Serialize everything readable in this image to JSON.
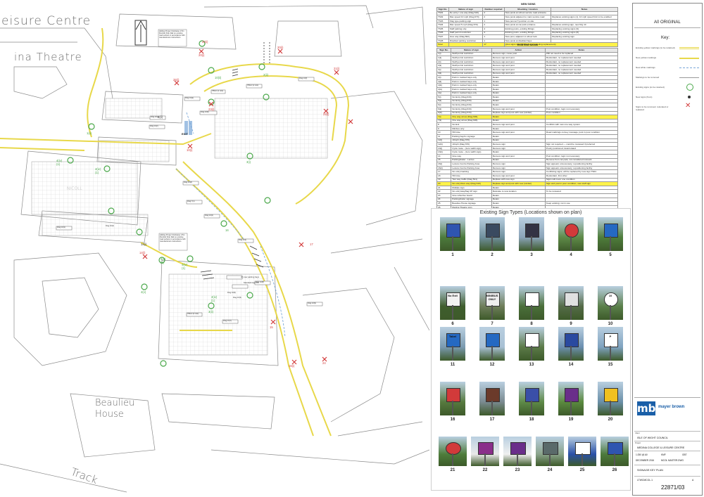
{
  "plan": {
    "labels": {
      "leisure": "eisure Centre",
      "theatre": "ina Theatre",
      "beaulieu1": "Beaulieu",
      "beaulieu2": "House",
      "track": "Track",
      "nicoll": "NICOLL"
    },
    "annotations": {
      "note_top": "Adding Proper Clockwise 1:5m Rumble Strip Rail on existing road surface in accordance with manufacturers instructions",
      "note_mid": "Adding Proper Clockwise 1:5m Rumble Strip Rail on existing road surface in accordance with manufacturers instructions",
      "exit": "EXIT",
      "disabled_bays": "(3) new parking bays",
      "standard_signs": "Standard sign 16"
    },
    "tags": [
      "20(i)",
      "20(i)",
      "21(i)",
      "25(i)",
      "23(i)",
      "2(ii)",
      "22(i)",
      "10(i)",
      "4(ii)",
      "1(ii)",
      "10(ii)",
      "3(i)",
      "4(iv)(1)",
      "4(iv)(1)",
      "4(iv)(1)",
      "4(iv)(1)",
      "4(v)",
      "4(v)(1)",
      "3(ii)",
      "14(i)",
      "17",
      "15",
      "16(i)",
      "16",
      "24",
      "20(i)",
      "14(i)"
    ],
    "callouts": [
      "Dwg 10(a)",
      "Dwg 10(b)",
      "TBGO (1 nos)",
      "TBGO (2 nos)",
      "Dwg 10(f)",
      "Dwg 10(e)",
      "Dwg 10(c)",
      "Dwg 10(d)",
      "Dwg 7(1)",
      "Dwg 10(1)",
      "Dwg 10(2)",
      "Dwg 10(i)",
      "Dwg 10(8)",
      "Dwg 10(9)",
      "Dwg 10(7)",
      "Dwg 10(6)",
      "Dwg 10(3)",
      "TBGO (4 nos)",
      "Dwg 10(4)"
    ]
  },
  "new_signs": {
    "caption": "NEW SIGNS",
    "headers": [
      "Sign No.",
      "Nature of sign",
      "Number required",
      "Mounting / location",
      "Notes"
    ],
    "rows": [
      [
        "TS01",
        "No entry / one way (Diag 616)",
        "2",
        "New posts at school service road entrance",
        ""
      ],
      [
        "TS02",
        "Max speed 10 mph (Diag 670)",
        "2",
        "New posts adjacent to main service road",
        "Replaces existing signs (1); 10 mph speed limit to be enabled"
      ],
      [
        "TS03",
        "Flag type parking sign",
        "1",
        "New post at T-junction on site",
        ""
      ],
      [
        "TS04",
        "Max speed 5 mph (Diag 670)",
        "2",
        "New posts at car park entrance",
        "Replaces existing sign, new Drg 10"
      ],
      [
        "TS05",
        "Staff parking only",
        "4",
        "Existing posts, existing fittings",
        "Replacing existing signs (9)"
      ],
      [
        "TS06",
        "Staff permit restriction",
        "4",
        "Existing posts, existing fittings",
        "Replacing existing signs (8)"
      ],
      [
        "TS07",
        "Give way (Diag 602)",
        "1",
        "New post, adjacent to wheel lock",
        "Replacing existing sign"
      ],
      [
        "TS08",
        "Disabled parking restriction",
        "1",
        "New posts at disabled bays",
        ""
      ]
    ],
    "total_label": "Total",
    "total_value": "17",
    "total_note": "(plus signs identified below as needing replacement)"
  },
  "existing_signs": {
    "caption": "EXISTING SIGNS",
    "headers": [
      "Sign No.",
      "Nature of sign",
      "Action",
      "Notes"
    ],
    "rows": [
      [
        "1(i)",
        "Staff permit restriction",
        "Remove sign, reuse post",
        "Will not need to be replaced"
      ],
      [
        "1(ii)",
        "Staff permit restriction",
        "Remove sign and post",
        "Redundant, no replacement needed"
      ],
      [
        "2(i)",
        "Staff permit restriction",
        "Remove sign and post",
        "Redundant, no replacement needed"
      ],
      [
        "2(ii)",
        "Staff permit restriction",
        "Remove sign and post",
        "Redundant, no replacement needed"
      ],
      [
        "3(i)",
        "Staff permit restriction",
        "Remove sign and post",
        "Redundant, no replacement needed"
      ],
      [
        "3(ii)",
        "Staff permit restriction",
        "Remove sign and post",
        "Redundant, no replacement needed"
      ],
      [
        "4(i)",
        "Park in marked bays only",
        "Retain",
        ""
      ],
      [
        "4(ii)",
        "Park in marked bays only",
        "Retain",
        ""
      ],
      [
        "4(iii)",
        "Park in marked bays only",
        "Retain",
        ""
      ],
      [
        "4(iv)",
        "Park in marked bays only",
        "Retain",
        ""
      ],
      [
        "4(v)",
        "Park in marked bays only",
        "Retain",
        ""
      ],
      [
        "5(i)",
        "No Entry (Diag 616)",
        "Retain",
        ""
      ],
      [
        "5(ii)",
        "No Entry (Diag 616)",
        "Retain",
        ""
      ],
      [
        "6(i)",
        "No Entry (Diag 616)",
        "Retain",
        ""
      ],
      [
        "6(ii)",
        "No Entry (Diag 616)",
        "Remove sign and post",
        "Post condition, logic not necessary"
      ],
      [
        "6(iii)",
        "No Entry (Diag 616)",
        "Replace sign and post with new (similar)",
        "Poor condition"
      ],
      [
        "7(i)",
        "One way arrow (Diag 606)",
        "Retain",
        ""
      ],
      [
        "7(ii)",
        "One way arrow (Diag 606)",
        "Retain",
        ""
      ],
      [
        "8",
        "No Exit",
        "Remove sign and post",
        "Conflicts with new one-way system"
      ],
      [
        "9",
        "Minibus only",
        "Retain",
        ""
      ],
      [
        "10",
        "Hill Give",
        "Remove sign and post",
        "Road markings convey message; post in poor condition"
      ],
      [
        "11",
        "Parking bay/no signage",
        "Retain",
        ""
      ],
      [
        "12(i)",
        "10mph (Diag 670)",
        "Retain",
        ""
      ],
      [
        "12(ii)",
        "10mph (Diag 670)",
        "Remove sign",
        "Sign not required — could be reviewed if preferred"
      ],
      [
        "13(i)",
        "Cycle route - (zero width sign)",
        "Remove sign",
        "Poorly positioned; deteriorated"
      ],
      [
        "13(ii)",
        "Cycle route - (zero width sign)",
        "Retain",
        ""
      ],
      [
        "14",
        "Give way",
        "Remove sign and post",
        "Post condition; logic not necessary"
      ],
      [
        "15",
        "Parking/trailer - Lorries",
        "Retain",
        "Remove from car park, not considered relevant"
      ],
      [
        "16(i)",
        "Leisure Centre Parking Area",
        "Remove sign",
        "Sign appears unnecessary; repositioning facility"
      ],
      [
        "16(ii)",
        "Leisure Centre Parking Area",
        "Remove sign",
        "Sign appears unnecessary; repositioning facility"
      ],
      [
        "17",
        "No entry/marking",
        "Remove sign",
        "Conflicting signs; will be replaced by new sign TS04"
      ],
      [
        "18",
        "Hill Give",
        "Remove sign and post",
        "Redundant, first other"
      ],
      [
        "19",
        "Two way traffic (Diag 521)",
        "Replace with new sign",
        "Signs will cover one condition"
      ],
      [
        "20",
        "No entry/Give way (Diag 616)",
        "Replace sign and post with new (similar)",
        "Sign and post in poor condition; new staff sign"
      ],
      [
        "21",
        "Multiple sign",
        "Retain",
        ""
      ],
      [
        "22",
        "No entry/way/flag CP sign",
        "Relocate to new location",
        "To be reviewed"
      ],
      [
        "23",
        "Give reflective board",
        "Retain",
        ""
      ],
      [
        "24",
        "Parking/trailer signage",
        "Retain",
        ""
      ],
      [
        "25",
        "Beaulieu House signage",
        "Retain",
        "Keep existing; not in use"
      ],
      [
        "26",
        "Medina Theatre sign",
        "Retain",
        ""
      ],
      [
        "27",
        "Medina Theatre sign",
        "Retain",
        ""
      ],
      [
        "28",
        "Information",
        "Remove sign",
        "Post condition; logic not necessary"
      ],
      [
        "29",
        "Information",
        "Remove sign",
        "Will not be replaced by new sign TS02"
      ]
    ],
    "highlight_rows": [
      16,
      33
    ]
  },
  "photos": {
    "title": "Existing Sign Types (Locations shown on plan)",
    "labels": [
      "No Exit",
      "MINIBUS ONLY",
      "10",
      "Tabel",
      "P"
    ],
    "numbers": [
      "1",
      "2",
      "3",
      "4",
      "5",
      "6",
      "7",
      "8",
      "9",
      "10",
      "11",
      "12",
      "13",
      "14",
      "15",
      "16",
      "17",
      "18",
      "19",
      "20",
      "21",
      "22",
      "23",
      "24",
      "25",
      "26"
    ]
  },
  "title_block": {
    "ao_original": "A0 ORIGINAL",
    "key_title": "Key:",
    "key_items": [
      "Existing yellow markings (to be retained)",
      "New yellow markings",
      "New white markings",
      "Markings to be removed",
      "Existing signs (to be retained)",
      "New signs (from)",
      "Signs to be removed, relocated or replaced"
    ],
    "company": "mayer brown",
    "logo": "mb",
    "client_label": "Client",
    "client": "ISLE OF WIGHT COUNCIL",
    "project_label": "Project",
    "project": "MEDINA COLLEGE & LEISURE CENTRE",
    "scale": "1:250 @ A0",
    "date": "DECEMBER 2016",
    "drawn": "KMF",
    "checked": "GBT",
    "file": "MCOL MASTER.DWG",
    "title": "SIGNAGE KEY PLAN",
    "ref": "LTWCMCOL.1",
    "rev": "A",
    "drawing_no": "22871/03"
  },
  "colors": {
    "yellow_marking": "#e8d84a",
    "white_marking": "#7aa7d8",
    "sign_green": "#4aa84a",
    "sign_red": "#d23a3a",
    "brand_blue": "#1a5fa8",
    "highlight": "#fff34a"
  }
}
